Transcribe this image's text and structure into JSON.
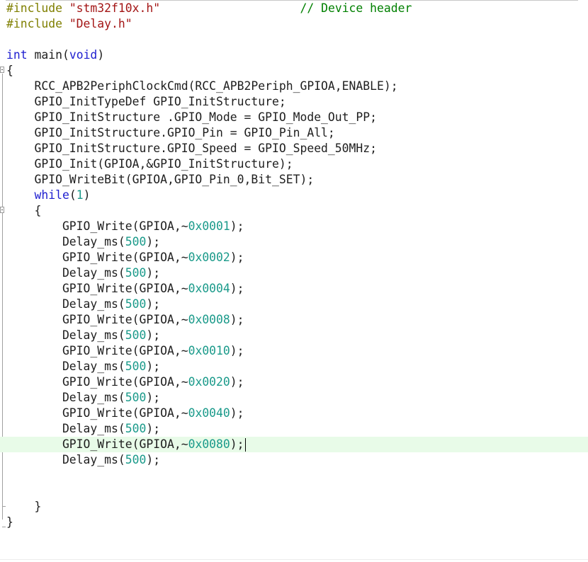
{
  "colors": {
    "preprocessor": "#7f7f00",
    "string": "#a31515",
    "comment": "#008000",
    "keyword": "#2020d0",
    "number": "#1a9a8a",
    "text": "#1e1e1e",
    "current_line_bg": "#e8fbe8"
  },
  "editor": {
    "lines": [
      {
        "tokens": [
          [
            "pp",
            "#include "
          ],
          [
            "str",
            "\"stm32f10x.h\""
          ],
          [
            "tx",
            "                    "
          ],
          [
            "cm",
            "// Device header"
          ]
        ]
      },
      {
        "tokens": [
          [
            "pp",
            "#include "
          ],
          [
            "str",
            "\"Delay.h\""
          ]
        ]
      },
      {
        "tokens": []
      },
      {
        "tokens": [
          [
            "kw",
            "int"
          ],
          [
            "tx",
            " main("
          ],
          [
            "kw",
            "void"
          ],
          [
            "tx",
            ")"
          ]
        ]
      },
      {
        "tokens": [
          [
            "tx",
            "{"
          ]
        ]
      },
      {
        "tokens": [
          [
            "tx",
            "    RCC_APB2PeriphClockCmd(RCC_APB2Periph_GPIOA,ENABLE);"
          ]
        ]
      },
      {
        "tokens": [
          [
            "tx",
            "    GPIO_InitTypeDef GPIO_InitStructure;"
          ]
        ]
      },
      {
        "tokens": [
          [
            "tx",
            "    GPIO_InitStructure .GPIO_Mode = GPIO_Mode_Out_PP;"
          ]
        ]
      },
      {
        "tokens": [
          [
            "tx",
            "    GPIO_InitStructure.GPIO_Pin = GPIO_Pin_All;"
          ]
        ]
      },
      {
        "tokens": [
          [
            "tx",
            "    GPIO_InitStructure.GPIO_Speed = GPIO_Speed_50MHz;"
          ]
        ]
      },
      {
        "tokens": [
          [
            "tx",
            "    GPIO_Init(GPIOA,&GPIO_InitStructure);"
          ]
        ]
      },
      {
        "tokens": [
          [
            "tx",
            "    GPIO_WriteBit(GPIOA,GPIO_Pin_0,Bit_SET);"
          ]
        ]
      },
      {
        "tokens": [
          [
            "tx",
            "    "
          ],
          [
            "kw",
            "while"
          ],
          [
            "tx",
            "("
          ],
          [
            "num",
            "1"
          ],
          [
            "tx",
            ")"
          ]
        ]
      },
      {
        "tokens": [
          [
            "tx",
            "    {"
          ]
        ]
      },
      {
        "tokens": [
          [
            "tx",
            "        GPIO_Write(GPIOA,~"
          ],
          [
            "num",
            "0x0001"
          ],
          [
            "tx",
            ");"
          ]
        ]
      },
      {
        "tokens": [
          [
            "tx",
            "        Delay_ms("
          ],
          [
            "num",
            "500"
          ],
          [
            "tx",
            ");"
          ]
        ]
      },
      {
        "tokens": [
          [
            "tx",
            "        GPIO_Write(GPIOA,~"
          ],
          [
            "num",
            "0x0002"
          ],
          [
            "tx",
            ");"
          ]
        ]
      },
      {
        "tokens": [
          [
            "tx",
            "        Delay_ms("
          ],
          [
            "num",
            "500"
          ],
          [
            "tx",
            ");"
          ]
        ]
      },
      {
        "tokens": [
          [
            "tx",
            "        GPIO_Write(GPIOA,~"
          ],
          [
            "num",
            "0x0004"
          ],
          [
            "tx",
            ");"
          ]
        ]
      },
      {
        "tokens": [
          [
            "tx",
            "        Delay_ms("
          ],
          [
            "num",
            "500"
          ],
          [
            "tx",
            ");"
          ]
        ]
      },
      {
        "tokens": [
          [
            "tx",
            "        GPIO_Write(GPIOA,~"
          ],
          [
            "num",
            "0x0008"
          ],
          [
            "tx",
            ");"
          ]
        ]
      },
      {
        "tokens": [
          [
            "tx",
            "        Delay_ms("
          ],
          [
            "num",
            "500"
          ],
          [
            "tx",
            ");"
          ]
        ]
      },
      {
        "tokens": [
          [
            "tx",
            "        GPIO_Write(GPIOA,~"
          ],
          [
            "num",
            "0x0010"
          ],
          [
            "tx",
            ");"
          ]
        ]
      },
      {
        "tokens": [
          [
            "tx",
            "        Delay_ms("
          ],
          [
            "num",
            "500"
          ],
          [
            "tx",
            ");"
          ]
        ]
      },
      {
        "tokens": [
          [
            "tx",
            "        GPIO_Write(GPIOA,~"
          ],
          [
            "num",
            "0x0020"
          ],
          [
            "tx",
            ");"
          ]
        ]
      },
      {
        "tokens": [
          [
            "tx",
            "        Delay_ms("
          ],
          [
            "num",
            "500"
          ],
          [
            "tx",
            ");"
          ]
        ]
      },
      {
        "tokens": [
          [
            "tx",
            "        GPIO_Write(GPIOA,~"
          ],
          [
            "num",
            "0x0040"
          ],
          [
            "tx",
            ");"
          ]
        ]
      },
      {
        "tokens": [
          [
            "tx",
            "        Delay_ms("
          ],
          [
            "num",
            "500"
          ],
          [
            "tx",
            ");"
          ]
        ]
      },
      {
        "tokens": [
          [
            "tx",
            "        GPIO_Write(GPIOA,~"
          ],
          [
            "num",
            "0x0080"
          ],
          [
            "tx",
            ");"
          ]
        ],
        "current": true,
        "caret": true
      },
      {
        "tokens": [
          [
            "tx",
            "        Delay_ms("
          ],
          [
            "num",
            "500"
          ],
          [
            "tx",
            ");"
          ]
        ]
      },
      {
        "tokens": []
      },
      {
        "tokens": []
      },
      {
        "tokens": [
          [
            "tx",
            "    }"
          ]
        ]
      },
      {
        "tokens": [
          [
            "tx",
            "}"
          ]
        ]
      }
    ]
  }
}
